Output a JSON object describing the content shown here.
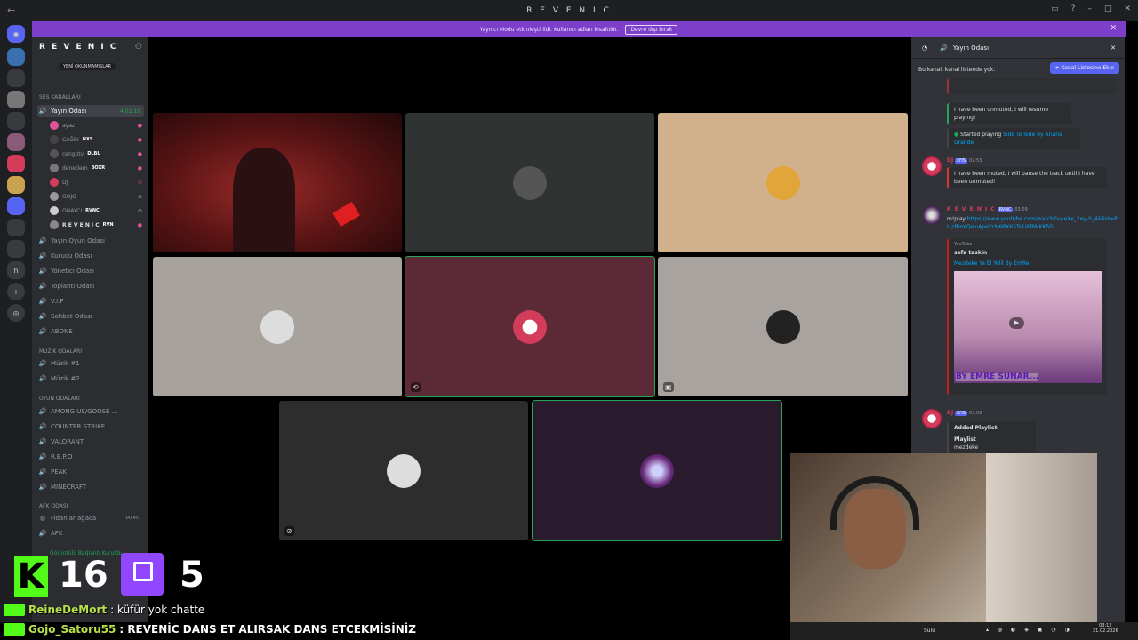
{
  "titlebar": {
    "title": "R E V E N I C"
  },
  "notice": {
    "text": "Yayıncı Modu etkinleştirildi. Kullanıcı adları kısaltıldı.",
    "button": "Devre dışı bırak"
  },
  "sidebar": {
    "server_name": "R E V E N I C",
    "unread_label": "YENİ OKUNMAMIŞLAR",
    "cat_voice": "SES KANALLARI",
    "active_channel": "Yayın Odası",
    "active_timer": "4:02:19",
    "users": [
      {
        "name": "ayaz",
        "tag": ""
      },
      {
        "name": "CAĞRI",
        "tag": "NXS"
      },
      {
        "name": "cengotv",
        "tag": "DLBL"
      },
      {
        "name": "denetlem",
        "tag": "BOXR"
      },
      {
        "name": "DJ",
        "tag": ""
      },
      {
        "name": "GOJO",
        "tag": ""
      },
      {
        "name": "ONAYCI",
        "tag": "RVNC"
      },
      {
        "name": "R E V E N I C",
        "tag": "RVN"
      }
    ],
    "channels": [
      "Yayın Oyun Odası",
      "Kurucu Odası",
      "Yönetici Odası",
      "Toplantı Odası",
      "V.I.P",
      "Sohbet Odası",
      "ABONE"
    ],
    "cat_music": "MÜZİK ODALARI",
    "music": [
      "Müzik #1",
      "Müzik #2"
    ],
    "cat_games": "OYUN ODALARI",
    "games": [
      "AMONG US/GOOSE ...",
      "COUNTER STRIKE",
      "VALORANT",
      "R.E.P.O",
      "PEAK",
      "MINECRAFT"
    ],
    "cat_afk": "AFK ODASI",
    "afk": [
      "Fidanlar ağaca",
      "AFK"
    ],
    "afk_counts": [
      "00",
      "45"
    ],
    "voice_status": "Görüntülü Bağlantı Kuruldu"
  },
  "chat": {
    "channel": "Yayın Odası",
    "banner": "Bu kanal, kanal listende yok.",
    "add_button": "+ Kanal Listesine Ekle",
    "m1": "I have been unmuted, I will resume playing!",
    "m2_prefix": "Started playing",
    "m2_song": "Side To Side by Ariana Grande",
    "dj_name": "DJ",
    "dj_badge": "LYIS",
    "dj_time1": "02:53",
    "m3": "I have been muted, I will pause the track until I have been unmuted!",
    "rev_name": "R E V E N I C",
    "rev_badge": "RVNC",
    "rev_time": "03:09",
    "cmd": "m!play",
    "url": "https://www.youtube.com/watch?v=eXe_2ey-S_4&list=PL-zBimlQwuApeYcN6BX65Ts1i6f6NKK5G",
    "yt_site": "YouTube",
    "yt_author": "sefa taskin",
    "yt_title": "Mezdeke  Ya El Yelil  By EmRe",
    "yt_banner": "BY EMRE SUNAR...",
    "dj_time2": "03:09",
    "m4_title": "Added Playlist",
    "m4_line1": "Playlist",
    "m4_line2": "mezdeke"
  },
  "overlay": {
    "kick_count": "16",
    "twitch_count": "5",
    "kick_logo": "K",
    "chat_lines": [
      {
        "user": "ReineDeMort",
        "text": ": küfür yok chatte"
      },
      {
        "user": "Gojo_Satoru55",
        "text": ": REVENİC DANS ET ALIRSAK DANS ETCEKMİSİNİZ"
      }
    ]
  },
  "taskbar": {
    "weather": "Sulu",
    "clock": "03:12",
    "date": "21.02.2026"
  },
  "colors": {
    "accent": "#5865f2",
    "speaking": "#23a55a",
    "notice": "#7d3fc9",
    "kick": "#53fc18",
    "twitch": "#9146ff"
  }
}
